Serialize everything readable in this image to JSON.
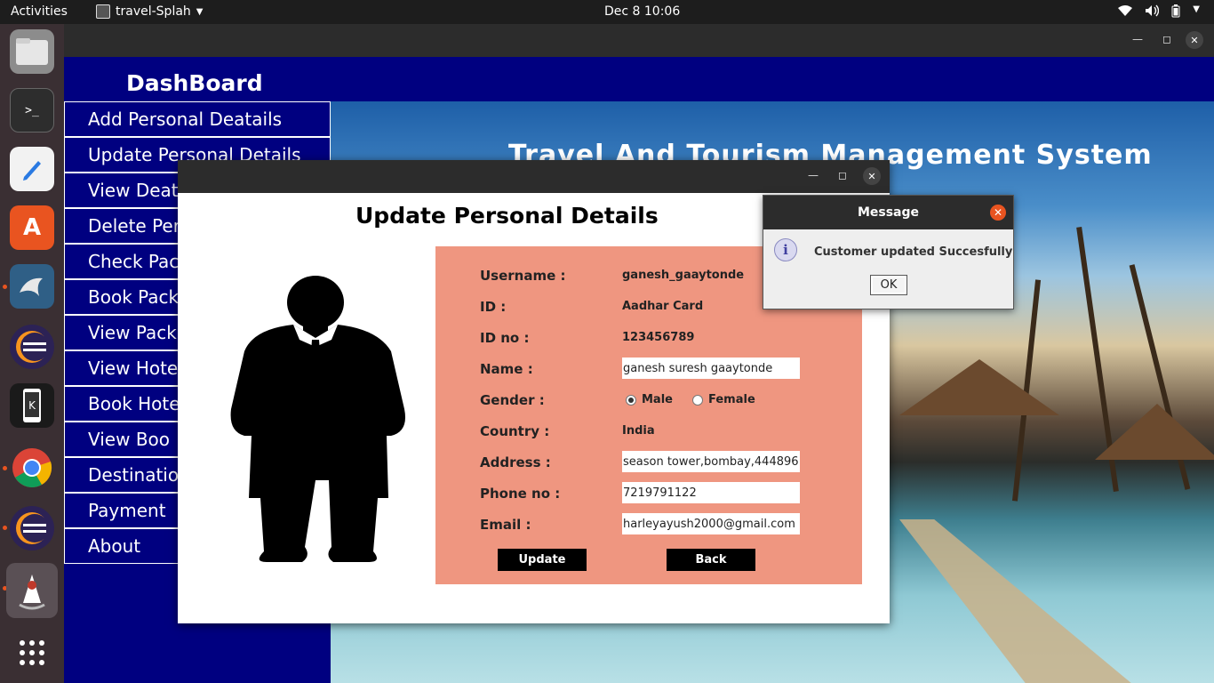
{
  "topbar": {
    "activities": "Activities",
    "app_name": "travel-Splah",
    "clock": "Dec 8  10:06"
  },
  "dock": {
    "icons": [
      "files-icon",
      "terminal-icon",
      "text-editor-icon",
      "software-store-icon",
      "mysql-workbench-icon",
      "eclipse-icon",
      "kde-connect-icon",
      "chrome-icon",
      "eclipse-icon-2",
      "java-icon",
      "app-grid-icon"
    ]
  },
  "dashboard": {
    "title": "DashBoard",
    "menu": [
      "Add Personal Deatails",
      "Update Personal Details",
      "View Deat",
      "Delete Per",
      "Check Pac",
      "Book Pack",
      "View Pack",
      "View Hote",
      "Book Hote",
      "View Boo",
      "Destinatio",
      "Payment",
      "About"
    ],
    "background_title": "Travel And Tourism Management System"
  },
  "update_dialog": {
    "heading": "Update Personal Details",
    "labels": {
      "username": "Username :",
      "id": "ID :",
      "id_no": "ID no :",
      "name": "Name :",
      "gender": "Gender :",
      "country": "Country :",
      "address": "Address :",
      "phone": "Phone no :",
      "email": "Email :"
    },
    "values": {
      "username": "ganesh_gaaytonde",
      "id": "Aadhar Card",
      "id_no": "123456789",
      "name": "ganesh suresh gaaytonde",
      "country": "India",
      "address": "season tower,bombay,444896",
      "phone": "7219791122",
      "email": "harleyayush2000@gmail.com"
    },
    "gender_options": [
      "Male",
      "Female"
    ],
    "gender_selected": "Male",
    "update_label": "Update",
    "back_label": "Back"
  },
  "message_dialog": {
    "title": "Message",
    "text": "Customer updated Succesfully",
    "ok_label": "OK"
  },
  "colors": {
    "menu_bg": "#000080",
    "form_bg": "#ef9680",
    "accent": "#e95420"
  }
}
